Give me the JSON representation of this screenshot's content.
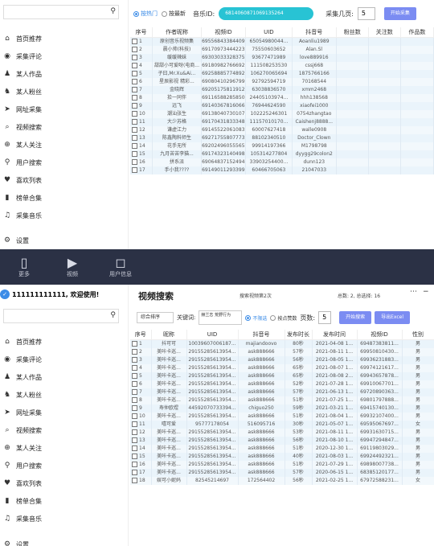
{
  "panel1": {
    "search": {
      "placeholder": ""
    },
    "nav": [
      {
        "icon": "home-icon",
        "glyph": "⌂",
        "label": "首页推荐"
      },
      {
        "icon": "comment-icon",
        "glyph": "◉",
        "label": "采集评论"
      },
      {
        "icon": "user-works-icon",
        "glyph": "♟",
        "label": "某人作品"
      },
      {
        "icon": "user-fans-icon",
        "glyph": "♞",
        "label": "某人粉丝"
      },
      {
        "icon": "send-icon",
        "glyph": "➤",
        "label": "网址采集"
      },
      {
        "icon": "search-icon",
        "glyph": "⌕",
        "label": "视频搜索"
      },
      {
        "icon": "follow-icon",
        "glyph": "⊕",
        "label": "某人关注"
      },
      {
        "icon": "user-search-icon",
        "glyph": "⚲",
        "label": "用户搜索"
      },
      {
        "icon": "like-icon",
        "glyph": "♥",
        "label": "喜欢列表"
      },
      {
        "icon": "ranking-icon",
        "glyph": "▮",
        "label": "榜单合集"
      },
      {
        "icon": "music-icon",
        "glyph": "♫",
        "label": "采集音乐"
      }
    ],
    "settings": {
      "icon": "gear-icon",
      "label": "设置"
    },
    "topbar": {
      "radio_a": "按热门",
      "radio_b": "按最新",
      "music_label": "音乐ID:",
      "music_value": "6814060871069135264",
      "pages_label": "采集几页:",
      "pages_value": "5",
      "start_button": "开始采集"
    },
    "columns": [
      "序号",
      "作者昵称",
      "视频ID",
      "UID",
      "抖音号",
      "粉丝数",
      "关注数",
      "作品数"
    ],
    "rows": [
      [
        "1",
        "原创音乐视频集",
        "69556843384409...",
        "65054980044...",
        "Aoanliu1989",
        "",
        "",
        ""
      ],
      [
        "2",
        "晨小帅(科技)",
        "69170973444223...",
        "75550603652",
        "Alan.Sl",
        "",
        "",
        ""
      ],
      [
        "3",
        "缓缓辣妹",
        "69303033328375...",
        "93677471989",
        "love889916",
        "",
        "",
        ""
      ],
      [
        "4",
        "甜甜小可爱呀(电商...",
        "69180982766692...",
        "111508253530",
        "cssj668",
        "",
        "",
        ""
      ],
      [
        "5",
        "子曰,Mr.Xu&Ai...",
        "69258885774892...",
        "106270065694",
        "1875766166",
        "",
        "",
        ""
      ],
      [
        "6",
        "星辰影视 精彩...",
        "69080410296799...",
        "92792594719",
        "70168544",
        "",
        "",
        ""
      ],
      [
        "7",
        "金晓辉",
        "69205175811912...",
        "63038836570",
        "xmm2468",
        "",
        "",
        ""
      ],
      [
        "8",
        "拾一同伴",
        "69116588285850...",
        "24405103974...",
        "hhh138568",
        "",
        "",
        ""
      ],
      [
        "9",
        "远飞",
        "69140367816066...",
        "76944624590",
        "xiaofei1000",
        "",
        "",
        ""
      ],
      [
        "10",
        "潮汕张生",
        "69138040730107...",
        "102225246301",
        "0754zhangtao",
        "",
        "",
        ""
      ],
      [
        "11",
        "大少苏格",
        "69170431833348...",
        "11157010170...",
        "Caishenj8888...",
        "",
        "",
        ""
      ],
      [
        "12",
        "谦虚江力",
        "69145522061083...",
        "60007627418",
        "walle0908",
        "",
        "",
        ""
      ],
      [
        "13",
        "陈鑫陶料师生",
        "69271755807773...",
        "88102340510",
        "Doctor_Clown",
        "",
        "",
        ""
      ],
      [
        "14",
        "花手无所",
        "69202496055565...",
        "99914197366",
        "M1798798",
        "",
        "",
        ""
      ],
      [
        "15",
        "九月苦苦李猫...",
        "69174323140498...",
        "105314277804",
        "dyygg29colon2",
        "",
        "",
        ""
      ],
      [
        "16",
        "拼系派",
        "69064837152494...",
        "33903254400...",
        "dunn123",
        "",
        "",
        ""
      ],
      [
        "17",
        "手小我????",
        "69149011293399...",
        "60466705063",
        "21047033",
        "",
        "",
        ""
      ]
    ]
  },
  "bottombar": {
    "items": [
      {
        "icon": "document-icon",
        "glyph": "▯",
        "label": "更多"
      },
      {
        "icon": "video-icon",
        "glyph": "▶",
        "label": "视频"
      },
      {
        "icon": "chat-icon",
        "glyph": "◻",
        "label": "用户信息"
      }
    ]
  },
  "panel2": {
    "welcome": "111111111111, 欢迎使用!",
    "title": "视频搜索",
    "status_text": "搜索视频第2次",
    "total_label": "总数: 2, 总选择: 16",
    "search": {
      "placeholder": ""
    },
    "nav": [
      {
        "icon": "home-icon",
        "glyph": "⌂",
        "label": "首页推荐"
      },
      {
        "icon": "comment-icon",
        "glyph": "◉",
        "label": "采集评论"
      },
      {
        "icon": "user-works-icon",
        "glyph": "♟",
        "label": "某人作品"
      },
      {
        "icon": "user-fans-icon",
        "glyph": "♞",
        "label": "某人粉丝"
      },
      {
        "icon": "send-icon",
        "glyph": "➤",
        "label": "网址采集"
      },
      {
        "icon": "search-icon",
        "glyph": "⌕",
        "label": "视频搜索"
      },
      {
        "icon": "follow-icon",
        "glyph": "⊕",
        "label": "某人关注"
      },
      {
        "icon": "user-search-icon",
        "glyph": "⚲",
        "label": "用户搜索"
      },
      {
        "icon": "like-icon",
        "glyph": "♥",
        "label": "喜欢列表"
      },
      {
        "icon": "ranking-icon",
        "glyph": "▮",
        "label": "榜单合集"
      },
      {
        "icon": "music-icon",
        "glyph": "♫",
        "label": "采集音乐"
      }
    ],
    "settings": {
      "icon": "gear-icon",
      "label": "设置"
    },
    "toolbar": {
      "sort_select": "综合排序",
      "keyword_label": "关键词:",
      "keyword_value": "赫兰志 荒野行为",
      "radio_a": "不限选",
      "radio_b": "按点赞数",
      "pages_label": "页数:",
      "pages_value": "5",
      "start_button": "开始搜索",
      "export_button": "导出Excel"
    },
    "columns": [
      "序号",
      "昵称",
      "UID",
      "抖音号",
      "发布时长",
      "发布时间",
      "视频ID",
      "性别"
    ],
    "rows": [
      [
        "1",
        "抖可可",
        "10039607006187...",
        "majiandoovo",
        "80秒",
        "2021-04-08 1...",
        "69487383811...",
        "男"
      ],
      [
        "2",
        "美咔卡巡...",
        "29155285613954...",
        "ask888666",
        "57秒",
        "2021-08-11 1...",
        "69950810430...",
        "男"
      ],
      [
        "3",
        "美咔卡巡...",
        "29155285613954...",
        "ask888666",
        "56秒",
        "2021-08-05 1...",
        "69936231883...",
        "男"
      ],
      [
        "4",
        "美咔卡巡...",
        "29155285613954...",
        "ask888666",
        "65秒",
        "2021-08-07 1...",
        "69974121617...",
        "男"
      ],
      [
        "5",
        "美咔卡巡...",
        "29155285613954...",
        "ask888666",
        "65秒",
        "2021-08-08 2...",
        "69943657878...",
        "男"
      ],
      [
        "6",
        "美咔卡巡...",
        "29155285613954...",
        "ask888666",
        "52秒",
        "2021-07-28 1...",
        "69910067701...",
        "男"
      ],
      [
        "7",
        "美咔卡巡...",
        "29155285613954...",
        "ask888666",
        "57秒",
        "2021-06-13 1...",
        "69720890363...",
        "男"
      ],
      [
        "8",
        "美咔卡巡...",
        "29155285613954...",
        "ask888666",
        "51秒",
        "2021-07-25 1...",
        "69801797888...",
        "男"
      ],
      [
        "9",
        "寿仲欧煜",
        "44592070733394...",
        "chiguo250",
        "59秒",
        "2021-03-21 1...",
        "69415740130...",
        "男"
      ],
      [
        "10",
        "美咔卡巡...",
        "29155285613954...",
        "ask888666",
        "51秒",
        "2021-08-04 1...",
        "69932107400...",
        "男"
      ],
      [
        "11",
        "嘻可爱",
        "95777178054",
        "516095716",
        "30秒",
        "2021-05-07 1...",
        "69595067697...",
        "女"
      ],
      [
        "12",
        "美咔卡巡...",
        "29155285613954...",
        "ask888666",
        "53秒",
        "2021-08-11 1...",
        "69931630715...",
        "男"
      ],
      [
        "13",
        "美咔卡巡...",
        "29155285613954...",
        "ask888666",
        "56秒",
        "2021-08-10 1...",
        "69947294847...",
        "男"
      ],
      [
        "14",
        "美咔卡巡...",
        "29155285613954...",
        "ask888666",
        "51秒",
        "2020-12-30 1...",
        "69119803029...",
        "男"
      ],
      [
        "15",
        "美咔卡巡...",
        "29155285613954...",
        "ask888666",
        "40秒",
        "2021-08-03 1...",
        "69924492321...",
        "男"
      ],
      [
        "16",
        "美咔卡巡...",
        "29155285613954...",
        "ask888666",
        "51秒",
        "2021-07-29 1...",
        "69898007738...",
        "男"
      ],
      [
        "17",
        "美咔卡巡...",
        "29155285613954...",
        "ask888666",
        "57秒",
        "2020-06-15 1...",
        "68385120177...",
        "男"
      ],
      [
        "18",
        "娱可小妮妈",
        "82545214697",
        "172564402",
        "56秒",
        "2021-02-25 1...",
        "67972588231...",
        "女"
      ]
    ]
  }
}
